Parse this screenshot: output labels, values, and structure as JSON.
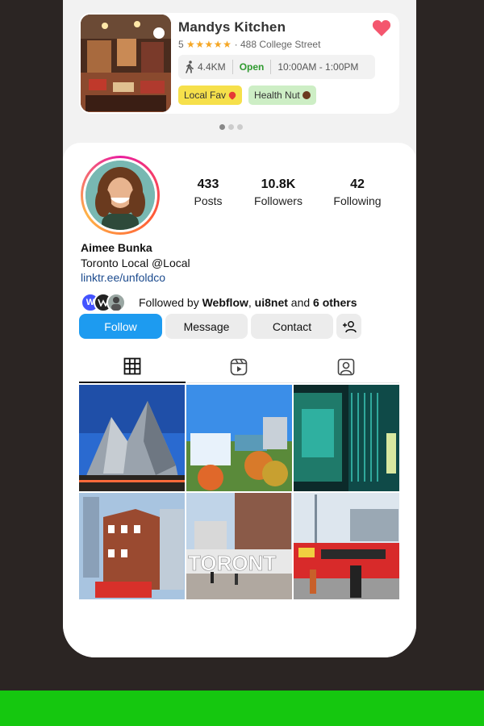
{
  "restaurant": {
    "name": "Mandys Kitchen",
    "rating": "5",
    "stars": "★★★★★",
    "address": "· 488 College Street",
    "distance": "4.4KM",
    "status": "Open",
    "hours": "10:00AM - 1:00PM",
    "tags": [
      "Local Fav",
      "Health Nut"
    ],
    "favorited": true
  },
  "carousel": {
    "pages": 3,
    "active": 1
  },
  "profile": {
    "stats": [
      {
        "value": "433",
        "label": "Posts"
      },
      {
        "value": "10.8K",
        "label": "Followers"
      },
      {
        "value": "42",
        "label": "Following"
      }
    ],
    "name": "Aimee Bunka",
    "bio": "Toronto Local @Local",
    "link": "linktr.ee/unfoldco",
    "followed_by": {
      "prefix": "Followed by ",
      "user1": "Webflow",
      "sep": ", ",
      "user2": "ui8net",
      "and": " and ",
      "others": "6 others"
    },
    "buttons": {
      "follow": "Follow",
      "message": "Message",
      "contact": "Contact"
    }
  },
  "tabs": [
    "grid",
    "reels",
    "tagged"
  ],
  "colors": {
    "accent": "#1d9bf0",
    "heart": "#f4566e",
    "open": "#2f9a2f",
    "background": "#2b2523",
    "bottom_bar": "#15c70f"
  }
}
